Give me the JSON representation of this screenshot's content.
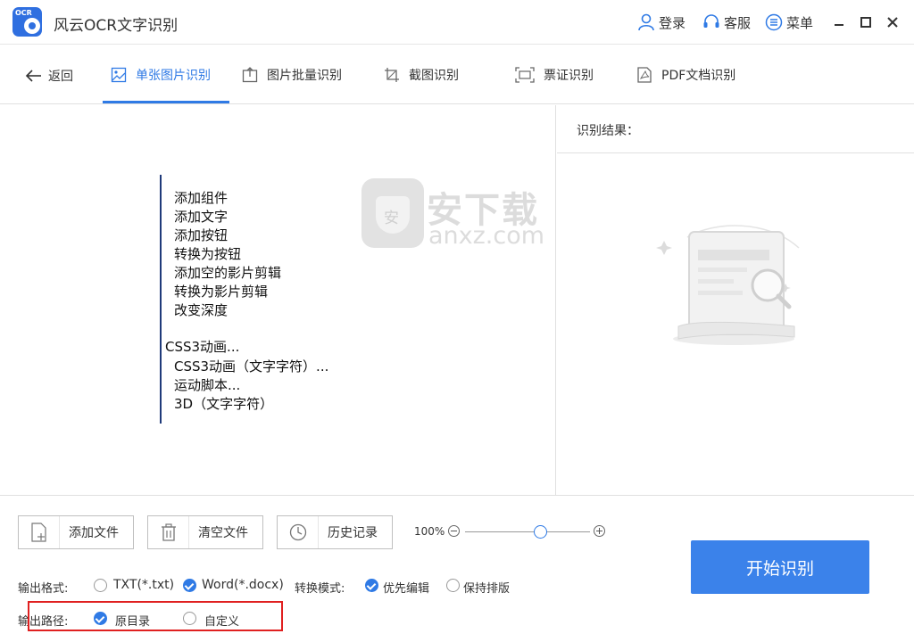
{
  "app": {
    "logo_text": "OCR",
    "title": "风云OCR文字识别"
  },
  "titlebar": {
    "login": "登录",
    "service": "客服",
    "menu": "菜单"
  },
  "nav": {
    "back": "返回",
    "tabs": [
      {
        "label": "单张图片识别",
        "active": true
      },
      {
        "label": "图片批量识别",
        "active": false
      },
      {
        "label": "截图识别",
        "active": false
      },
      {
        "label": "票证识别",
        "active": false
      },
      {
        "label": "PDF文档识别",
        "active": false
      }
    ]
  },
  "preview": {
    "lines": [
      "添加组件",
      "添加文字",
      "添加按钮",
      "转换为按钮",
      "添加空的影片剪辑",
      "转换为影片剪辑",
      "改变深度",
      "CSS3动画...",
      "CSS3动画（文字字符）...",
      "运动脚本...",
      "3D（文字字符）"
    ],
    "watermark": {
      "shield_char": "安",
      "cn": "安下载",
      "en": "anxz.com"
    }
  },
  "result": {
    "label": "识别结果："
  },
  "toolbar": {
    "add_file": "添加文件",
    "clear_files": "清空文件",
    "history": "历史记录",
    "zoom": "100%",
    "zoom_value": 0.6
  },
  "options": {
    "format_label": "输出格式:",
    "format_txt": "TXT(*.txt)",
    "format_word": "Word(*.docx)",
    "format_selected": "Word(*.docx)",
    "mode_label": "转换模式:",
    "mode_edit": "优先编辑",
    "mode_layout": "保持排版",
    "mode_selected": "优先编辑",
    "path_label": "输出路径:",
    "path_original": "原目录",
    "path_custom": "自定义",
    "path_selected": "原目录"
  },
  "start_button": "开始识别",
  "colors": {
    "accent": "#3b82ea",
    "tab_active": "#2f7ae5",
    "logo": "#2f6fe0",
    "highlight": "#e02020"
  }
}
